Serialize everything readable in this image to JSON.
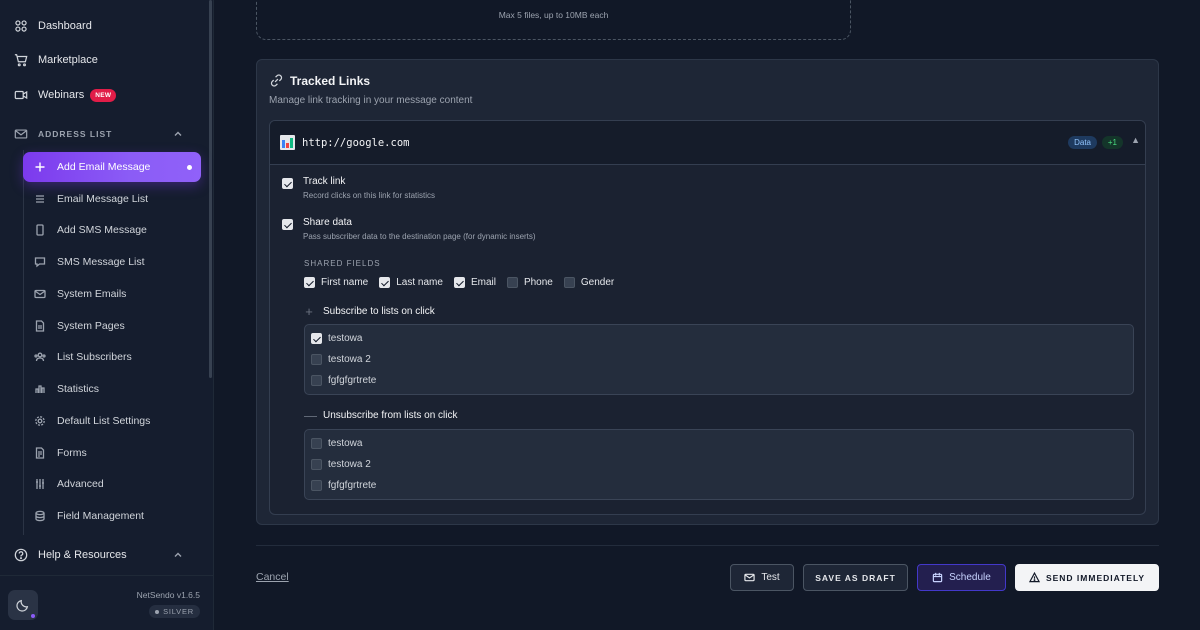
{
  "sidebar": {
    "top_items": [
      {
        "label": "Dashboard",
        "icon": "grid-icon"
      },
      {
        "label": "Marketplace",
        "icon": "cart-icon"
      },
      {
        "label": "Webinars",
        "icon": "video-icon",
        "badge": "NEW"
      }
    ],
    "section": {
      "label": "ADDRESS LIST",
      "icon": "mail-icon"
    },
    "active_item": {
      "label": "Add Email Message",
      "icon": "plus-icon"
    },
    "sub_items": [
      {
        "label": "Email Message List",
        "icon": "list-icon"
      },
      {
        "label": "Add SMS Message",
        "icon": "phone-icon"
      },
      {
        "label": "SMS Message List",
        "icon": "chat-icon"
      },
      {
        "label": "System Emails",
        "icon": "envelope-icon"
      },
      {
        "label": "System Pages",
        "icon": "page-icon"
      },
      {
        "label": "List Subscribers",
        "icon": "users-icon"
      },
      {
        "label": "Statistics",
        "icon": "chart-icon"
      },
      {
        "label": "Default List Settings",
        "icon": "gear-icon"
      },
      {
        "label": "Forms",
        "icon": "form-icon"
      },
      {
        "label": "Advanced",
        "icon": "sliders-icon"
      },
      {
        "label": "Field Management",
        "icon": "database-icon"
      }
    ],
    "help": {
      "label": "Help & Resources",
      "icon": "help-icon"
    },
    "version": "NetSendo v1.6.5",
    "tier": "SILVER"
  },
  "upload": {
    "hint": "Max 5 files, up to 10MB each"
  },
  "tracked_links": {
    "title": "Tracked Links",
    "subtitle": "Manage link tracking in your message content",
    "link": {
      "url": "http://google.com",
      "tags": [
        "Data",
        "+1"
      ],
      "collapse": "▲"
    },
    "track": {
      "title": "Track link",
      "desc": "Record clicks on this link for statistics",
      "checked": true
    },
    "share": {
      "title": "Share data",
      "desc": "Pass subscriber data to the destination page (for dynamic inserts)",
      "checked": true
    },
    "shared_fields_label": "SHARED FIELDS",
    "shared_fields": [
      {
        "label": "First name",
        "checked": true
      },
      {
        "label": "Last name",
        "checked": true
      },
      {
        "label": "Email",
        "checked": true
      },
      {
        "label": "Phone",
        "checked": false
      },
      {
        "label": "Gender",
        "checked": false
      }
    ],
    "subscribe": {
      "label": "Subscribe to lists on click",
      "symbol": "+",
      "lists": [
        {
          "label": "testowa",
          "checked": true
        },
        {
          "label": "testowa 2",
          "checked": false
        },
        {
          "label": "fgfgfgrtrete",
          "checked": false
        }
      ]
    },
    "unsubscribe": {
      "label": "Unsubscribe from lists on click",
      "symbol": "—",
      "lists": [
        {
          "label": "testowa",
          "checked": false
        },
        {
          "label": "testowa 2",
          "checked": false
        },
        {
          "label": "fgfgfgrtrete",
          "checked": false
        }
      ]
    }
  },
  "footer": {
    "cancel": "Cancel",
    "test": "Test",
    "draft": "SAVE AS DRAFT",
    "schedule": "Schedule",
    "send": "SEND IMMEDIATELY"
  }
}
